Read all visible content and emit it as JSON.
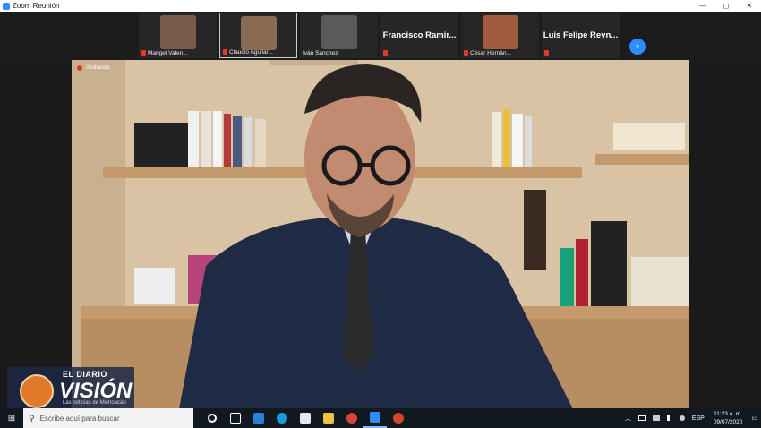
{
  "window": {
    "title": "Zoom Reunión"
  },
  "controls": {
    "minimize": "—",
    "maximize": "◻",
    "close": "✕"
  },
  "participants": [
    {
      "name": "Marigel Valen...",
      "face_color": "#7a5a48"
    },
    {
      "name": "Claudio Aguilar...",
      "face_color": "#8a6a50"
    },
    {
      "name": "Iván Sánchez",
      "face_color": "#5a5a5a"
    },
    {
      "name": "Francisco  Ramir..."
    },
    {
      "name": "César Hernán...",
      "face_color": "#a05a40"
    },
    {
      "name": "Luis Felipe  Reyn..."
    }
  ],
  "next_icon": "›",
  "recording": {
    "label": "Grabando"
  },
  "logo": {
    "line1": "EL DIARIO",
    "line2": "VISIÓN",
    "line3": "Las noticias de Michoacán"
  },
  "taskbar": {
    "start_icon": "⊞",
    "search_placeholder": "Escribe aquí para buscar",
    "search_icon": "⚲",
    "tray_chevron": "︿",
    "language": "ESP",
    "time": "11:23 a. m.",
    "date": "09/07/2020",
    "notification_icon": "▭"
  }
}
